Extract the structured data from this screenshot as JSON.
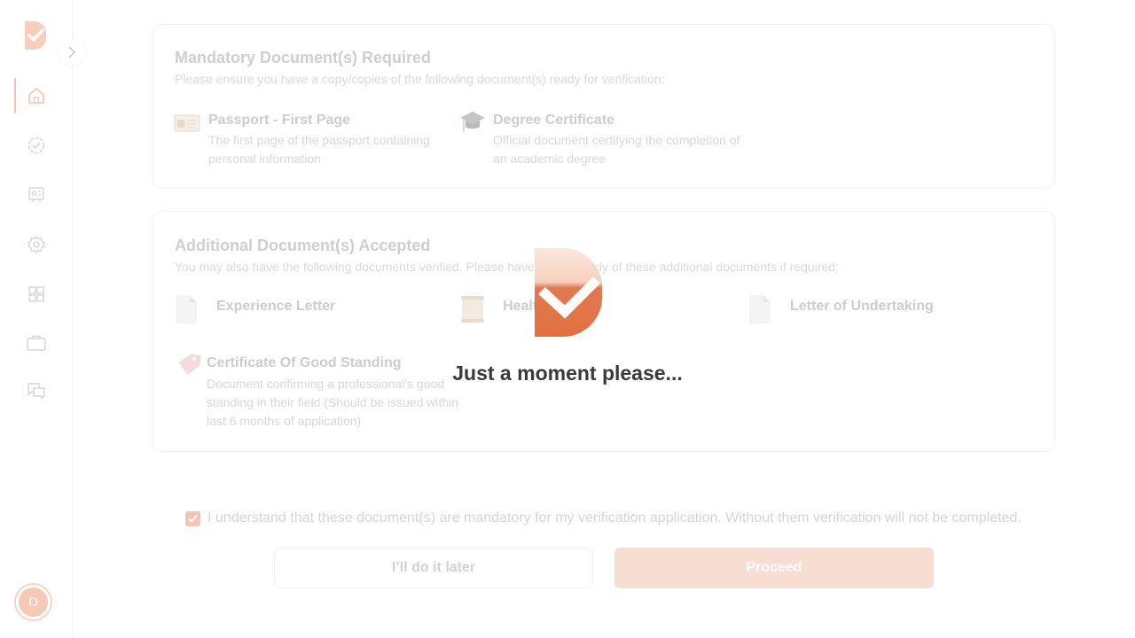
{
  "sidebar": {
    "avatar_initial": "D",
    "nav_items": [
      {
        "icon": "home-icon",
        "active": true
      },
      {
        "icon": "verified-badge-icon",
        "active": false
      },
      {
        "icon": "id-card-icon",
        "active": false
      },
      {
        "icon": "gear-icon",
        "active": false
      },
      {
        "icon": "grid-icon",
        "active": false
      },
      {
        "icon": "briefcase-icon",
        "active": false
      },
      {
        "icon": "chat-icon",
        "active": false
      }
    ]
  },
  "mandatory": {
    "title": "Mandatory Document(s) Required",
    "subtitle": "Please ensure you have a copy/copies of the following document(s) ready for verification:",
    "docs": [
      {
        "name": "Passport - First Page",
        "desc": "The first page of the passport containing personal information",
        "icon": "passport-icon"
      },
      {
        "name": "Degree Certificate",
        "desc": "Official document certifying the completion of an academic degree",
        "icon": "graduation-cap-icon"
      }
    ]
  },
  "additional": {
    "title": "Additional Document(s) Accepted",
    "subtitle": "You may also have the following documents verified. Please have copies ready of these additional documents if required:",
    "docs": [
      {
        "name": "Experience Letter",
        "icon": "document-icon"
      },
      {
        "name": "Health License",
        "icon": "scroll-icon"
      },
      {
        "name": "Letter of Undertaking",
        "icon": "document-icon"
      },
      {
        "name": "Certificate Of Good Standing",
        "desc": "Document confirming a professional's good standing in their field (Should be issued within last 6 months of application)",
        "icon": "certificate-tag-icon"
      }
    ]
  },
  "footer": {
    "consent_text": "I understand that these document(s) are mandatory for my verification application. Without them verification will not be completed.",
    "consent_checked": true,
    "later_label": "I’ll do it later",
    "proceed_label": "Proceed"
  },
  "loader": {
    "message": "Just a moment please..."
  },
  "colors": {
    "accent": "#e0693e",
    "accent_faded": "#f8ddd2"
  }
}
